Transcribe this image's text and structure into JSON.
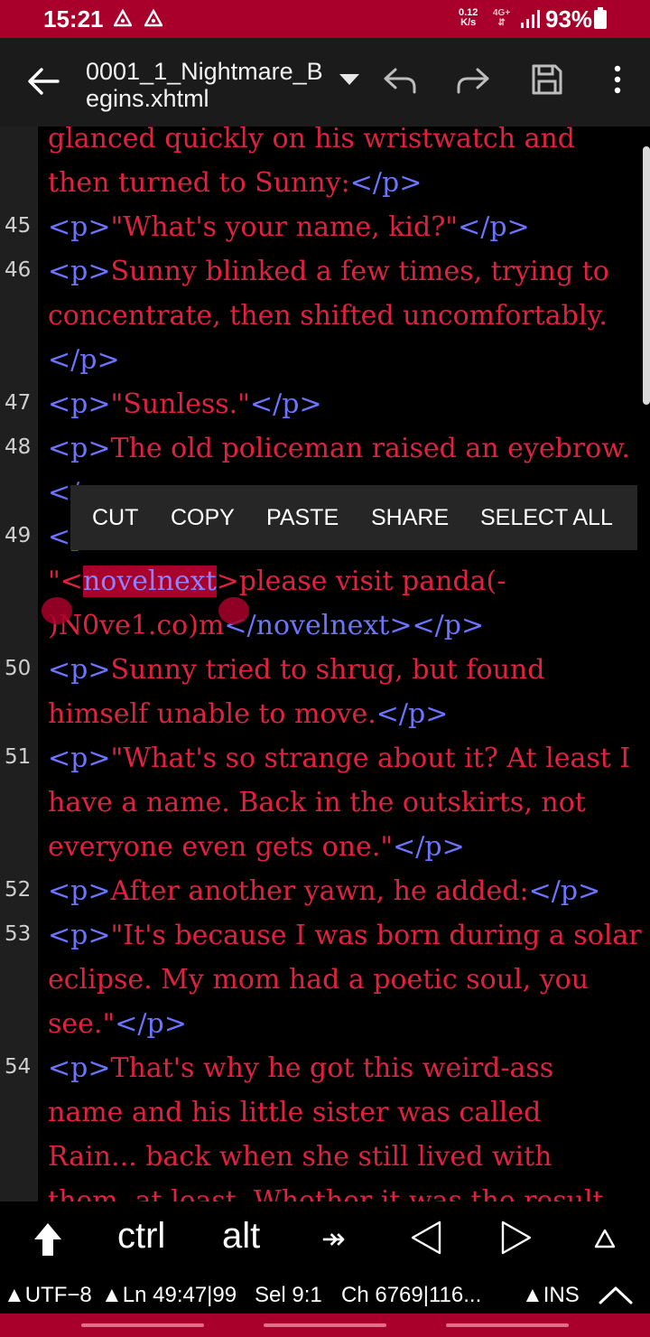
{
  "status_bar": {
    "time": "15:21",
    "net_speed_value": "0.12",
    "net_speed_unit": "K/s",
    "network": "4G+",
    "battery": "93%"
  },
  "toolbar": {
    "filename_line1": "0001_1_Nightmare_B",
    "filename_line2": "egins.xhtml"
  },
  "editor": {
    "lines": [
      {
        "num": "",
        "segments": [
          {
            "t": "glanced quickly on his wristwatch and",
            "c": "text"
          }
        ]
      },
      {
        "num": "",
        "segments": [
          {
            "t": "then turned to Sunny:",
            "c": "text"
          },
          {
            "t": "</p>",
            "c": "tag"
          }
        ]
      },
      {
        "num": "45",
        "segments": [
          {
            "t": "<p>",
            "c": "tag"
          },
          {
            "t": "\"What's your name, kid?\"",
            "c": "text"
          },
          {
            "t": "</p>",
            "c": "tag"
          }
        ]
      },
      {
        "num": "46",
        "segments": [
          {
            "t": "<p>",
            "c": "tag"
          },
          {
            "t": "Sunny blinked a few times, trying to",
            "c": "text"
          }
        ]
      },
      {
        "num": "",
        "segments": [
          {
            "t": "concentrate, then shifted uncomfortably.",
            "c": "text"
          }
        ]
      },
      {
        "num": "",
        "segments": [
          {
            "t": "</p>",
            "c": "tag"
          }
        ]
      },
      {
        "num": "47",
        "segments": [
          {
            "t": "<p>",
            "c": "tag"
          },
          {
            "t": "\"Sunless.\"",
            "c": "text"
          },
          {
            "t": "</p>",
            "c": "tag"
          }
        ]
      },
      {
        "num": "48",
        "segments": [
          {
            "t": "<p>",
            "c": "tag"
          },
          {
            "t": "The old policeman raised an eyebrow.",
            "c": "text"
          }
        ]
      },
      {
        "num": "",
        "segments": [
          {
            "t": "</p>",
            "c": "tag"
          }
        ]
      },
      {
        "num": "49",
        "segments": [
          {
            "t": "<p",
            "c": "tag"
          }
        ]
      },
      {
        "num": "",
        "segments": [
          {
            "t": "\"<",
            "c": "text"
          },
          {
            "t": "novelnext",
            "c": "sel"
          },
          {
            "t": ">please visit panda(-",
            "c": "text"
          }
        ]
      },
      {
        "num": "",
        "segments": [
          {
            "t": ")N0ve1.co)m",
            "c": "text"
          },
          {
            "t": "</novelnext></p>",
            "c": "tag"
          }
        ]
      },
      {
        "num": "50",
        "segments": [
          {
            "t": "<p>",
            "c": "tag"
          },
          {
            "t": "Sunny tried to shrug, but found",
            "c": "text"
          }
        ]
      },
      {
        "num": "",
        "segments": [
          {
            "t": "himself unable to move.",
            "c": "text"
          },
          {
            "t": "</p>",
            "c": "tag"
          }
        ]
      },
      {
        "num": "51",
        "segments": [
          {
            "t": "<p>",
            "c": "tag"
          },
          {
            "t": "\"What's so strange about it? At least I",
            "c": "text"
          }
        ]
      },
      {
        "num": "",
        "segments": [
          {
            "t": "have a name. Back in the outskirts, not",
            "c": "text"
          }
        ]
      },
      {
        "num": "",
        "segments": [
          {
            "t": "everyone even gets one.\"",
            "c": "text"
          },
          {
            "t": "</p>",
            "c": "tag"
          }
        ]
      },
      {
        "num": "52",
        "segments": [
          {
            "t": "<p>",
            "c": "tag"
          },
          {
            "t": "After another yawn, he added:",
            "c": "text"
          },
          {
            "t": "</p>",
            "c": "tag"
          }
        ]
      },
      {
        "num": "53",
        "segments": [
          {
            "t": "<p>",
            "c": "tag"
          },
          {
            "t": "\"It's because I was born during a solar",
            "c": "text"
          }
        ]
      },
      {
        "num": "",
        "segments": [
          {
            "t": "eclipse. My mom had a poetic soul, you",
            "c": "text"
          }
        ]
      },
      {
        "num": "",
        "segments": [
          {
            "t": "see.\"",
            "c": "text"
          },
          {
            "t": "</p>",
            "c": "tag"
          }
        ]
      },
      {
        "num": "54",
        "segments": [
          {
            "t": "<p>",
            "c": "tag"
          },
          {
            "t": "That's why he got this weird-ass",
            "c": "text"
          }
        ]
      },
      {
        "num": "",
        "segments": [
          {
            "t": "name and his little sister was called",
            "c": "text"
          }
        ]
      },
      {
        "num": "",
        "segments": [
          {
            "t": "Rain... back when she still lived with",
            "c": "text"
          }
        ]
      },
      {
        "num": "",
        "segments": [
          {
            "t": "them, at least. Whether it was the result",
            "c": "text"
          }
        ]
      }
    ]
  },
  "context_menu": {
    "cut": "CUT",
    "copy": "COPY",
    "paste": "PASTE",
    "share": "SHARE",
    "select_all": "SELECT ALL"
  },
  "keyboard_bar": {
    "ctrl": "ctrl",
    "alt": "alt",
    "tab": "↠"
  },
  "info_bar": {
    "encoding": "▲UTF−8",
    "line": "▲Ln 49:47|99",
    "selection": "Sel 9:1",
    "chars": "Ch 6769|116...",
    "mode": "▲INS"
  },
  "colors": {
    "accent": "#a8002a",
    "text": "#e0213f",
    "tag": "#6c74ff",
    "gutter": "#1f1f1f"
  }
}
